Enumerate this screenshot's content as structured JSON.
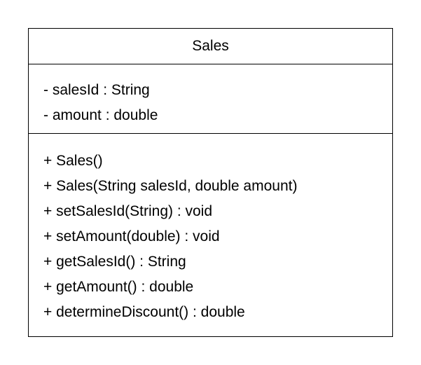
{
  "class": {
    "name": "Sales",
    "attributes": [
      "- salesId : String",
      "- amount : double"
    ],
    "methods": [
      "+ Sales()",
      "+ Sales(String salesId, double amount)",
      "+ setSalesId(String) : void",
      "+ setAmount(double) : void",
      "+ getSalesId() : String",
      "+ getAmount() : double",
      "+ determineDiscount() : double"
    ]
  }
}
